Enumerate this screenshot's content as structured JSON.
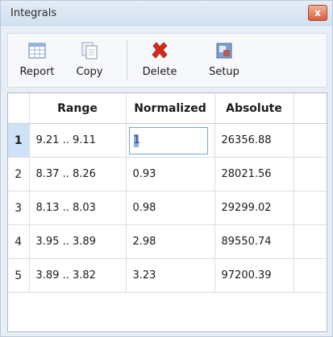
{
  "window": {
    "title": "Integrals",
    "close_glyph": "x"
  },
  "toolbar": {
    "report_label": "Report",
    "copy_label": "Copy",
    "delete_label": "Delete",
    "setup_label": "Setup"
  },
  "table": {
    "columns": [
      "Range",
      "Normalized",
      "Absolute"
    ],
    "rows": [
      {
        "num": "1",
        "range": "9.21 .. 9.11",
        "normalized": "1",
        "absolute": "26356.88"
      },
      {
        "num": "2",
        "range": "8.37 .. 8.26",
        "normalized": "0.93",
        "absolute": "28021.56"
      },
      {
        "num": "3",
        "range": "8.13 .. 8.03",
        "normalized": "0.98",
        "absolute": "29299.02"
      },
      {
        "num": "4",
        "range": "3.95 .. 3.89",
        "normalized": "2.98",
        "absolute": "89550.74"
      },
      {
        "num": "5",
        "range": "3.89 .. 3.82",
        "normalized": "3.23",
        "absolute": "97200.39"
      }
    ]
  },
  "colors": {
    "accent": "#3568c4",
    "delete_red": "#d92a1c",
    "selection": "#cfe2f7"
  }
}
